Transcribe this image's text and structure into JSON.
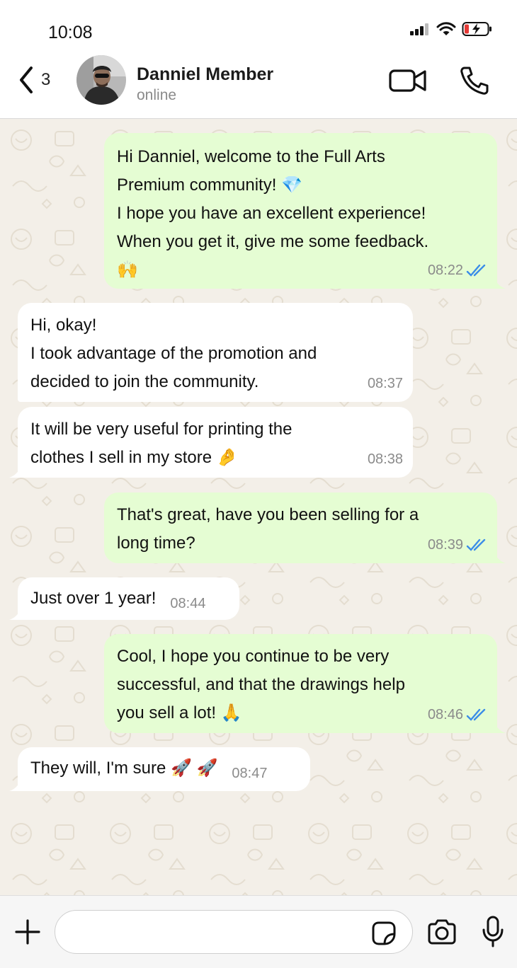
{
  "status_bar": {
    "time": "10:08"
  },
  "header": {
    "back_count": "3",
    "contact_name": "Danniel Member",
    "contact_status": "online"
  },
  "messages": [
    {
      "dir": "out",
      "text": "Hi Danniel, welcome to the Full Arts\nPremium community! 💎\nI hope you have an excellent experience!\nWhen you get it, give me some feedback.\n🙌",
      "time": "08:22",
      "ticks": "read"
    },
    {
      "dir": "in",
      "text": "Hi, okay!\nI took advantage of the promotion and\ndecided to join the community.",
      "time": "08:37"
    },
    {
      "dir": "in",
      "text": "It will be very useful for printing the\nclothes I sell in my store 🤌",
      "time": "08:38"
    },
    {
      "dir": "out",
      "text": "That's great, have you been selling for a\nlong time?",
      "time": "08:39",
      "ticks": "read"
    },
    {
      "dir": "in",
      "text": "Just over 1 year!",
      "time": "08:44"
    },
    {
      "dir": "out",
      "text": "Cool, I hope you continue to be very\nsuccessful, and that the drawings help\nyou sell a lot! 🙏",
      "time": "08:46",
      "ticks": "read"
    },
    {
      "dir": "in",
      "text": "They will, I'm sure 🚀 🚀",
      "time": "08:47"
    }
  ],
  "input": {
    "placeholder": "",
    "value": ""
  },
  "colors": {
    "outgoing_bubble": "#e5fdd3",
    "incoming_bubble": "#ffffff",
    "read_ticks": "#3b8de8",
    "chat_background": "#f3efe8"
  }
}
